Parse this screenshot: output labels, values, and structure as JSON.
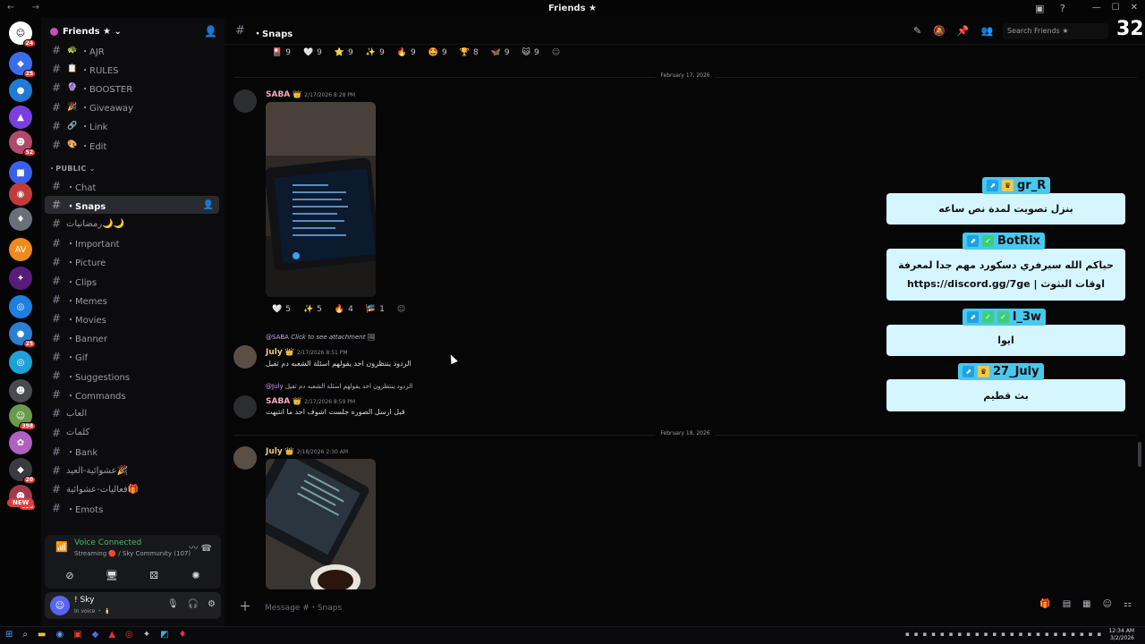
{
  "window": {
    "title": "Friends ★",
    "nav": "← →"
  },
  "colors": {
    "accent": "#5865f2",
    "voice": "#3fbd6a",
    "panel": "#d6f6ff",
    "tag": "#49c8ee",
    "saba": "#f0a8c0",
    "july": "#f0c674"
  },
  "servers": [
    {
      "icon": "☺",
      "color": "#ffffff",
      "badge": "24"
    },
    {
      "icon": "◆",
      "color": "#3a6ee8",
      "badge": "25"
    },
    {
      "icon": "●",
      "color": "#1f7bd6",
      "badge": ""
    },
    {
      "icon": "▲",
      "color": "#7a3fe0",
      "badge": ""
    },
    {
      "icon": "☻",
      "color": "#b04a6a",
      "badge": "52"
    },
    {
      "icon": "■",
      "color": "#3a5fe8",
      "badge": ""
    },
    {
      "icon": "◉",
      "color": "#c23b3b",
      "badge": ""
    },
    {
      "icon": "♦",
      "color": "#6b6f7a",
      "badge": ""
    },
    {
      "icon": "AV",
      "color": "#f08a1c",
      "badge": ""
    },
    {
      "icon": "✦",
      "color": "#5a1c7a",
      "badge": ""
    },
    {
      "icon": "◎",
      "color": "#1d7fe0",
      "badge": ""
    },
    {
      "icon": "●",
      "color": "#2a7fd0",
      "badge": "25"
    },
    {
      "icon": "◎",
      "color": "#1fa0d6",
      "badge": ""
    },
    {
      "icon": "☻",
      "color": "#4a4b50",
      "badge": ""
    },
    {
      "icon": "☺",
      "color": "#6a9a4a",
      "badge": "398"
    },
    {
      "icon": "✿",
      "color": "#b060c0",
      "badge": ""
    },
    {
      "icon": "◆",
      "color": "#3a3b40",
      "badge": "20"
    },
    {
      "icon": "☻",
      "color": "#a03a4a",
      "badge": "398"
    }
  ],
  "new_badge": "NEW",
  "guild": {
    "name": "Friends ★ ⌄"
  },
  "channels_top": [
    {
      "emoji": "🐢",
      "label": "・AJR"
    },
    {
      "emoji": "📋",
      "label": "・RULES"
    },
    {
      "emoji": "🔮",
      "label": "・BOOSTER"
    },
    {
      "emoji": "🎉",
      "label": "・Giveaway"
    },
    {
      "emoji": "🔗",
      "label": "・Link"
    },
    {
      "emoji": "🎨",
      "label": "・Edit"
    }
  ],
  "category_public": "・PUBLIC ⌄",
  "channels_public": [
    {
      "emoji": "",
      "label": "・Chat"
    },
    {
      "emoji": "",
      "label": "・Snaps"
    },
    {
      "emoji": "",
      "label": "رمضانيات🌙🌙"
    },
    {
      "emoji": "",
      "label": "・Important"
    },
    {
      "emoji": "",
      "label": "・Picture"
    },
    {
      "emoji": "",
      "label": "・Clips"
    },
    {
      "emoji": "",
      "label": "・Memes"
    },
    {
      "emoji": "",
      "label": "・Movies"
    },
    {
      "emoji": "",
      "label": "・Banner"
    },
    {
      "emoji": "",
      "label": "・Gif"
    },
    {
      "emoji": "",
      "label": "・Suggestions"
    },
    {
      "emoji": "",
      "label": "・Commands"
    },
    {
      "emoji": "",
      "label": "العاب"
    },
    {
      "emoji": "",
      "label": "كلمات"
    },
    {
      "emoji": "",
      "label": "・Bank"
    },
    {
      "emoji": "",
      "label": "عشوائية-العيد🎉"
    },
    {
      "emoji": "",
      "label": "فعاليات-عشوائية🎁"
    },
    {
      "emoji": "",
      "label": "・Emots"
    }
  ],
  "voice": {
    "status": "Voice Connected",
    "detail": "Streaming 🔴 / Sky Community (107)"
  },
  "user": {
    "name": "! Sky",
    "status": "In voice ・ 🕯️"
  },
  "header": {
    "channel": "・Snaps",
    "search_placeholder": "Search Friends ★"
  },
  "overlay_number": "32",
  "reactions_top": [
    {
      "e": "🎴",
      "n": "9"
    },
    {
      "e": "🤍",
      "n": "9"
    },
    {
      "e": "⭐",
      "n": "9"
    },
    {
      "e": "✨",
      "n": "9"
    },
    {
      "e": "🔥",
      "n": "9"
    },
    {
      "e": "🤩",
      "n": "9"
    },
    {
      "e": "🏆",
      "n": "8"
    },
    {
      "e": "🦋",
      "n": "9"
    },
    {
      "e": "😺",
      "n": "9"
    }
  ],
  "date1": "February 17, 2026",
  "date2": "February 18, 2026",
  "messages": {
    "m1": {
      "author": "SABA",
      "crown": "👑",
      "time": "2/17/2026 8:28 PM"
    },
    "m1_reacts": [
      {
        "e": "🤍",
        "n": "5"
      },
      {
        "e": "✨",
        "n": "5"
      },
      {
        "e": "🔥",
        "n": "4"
      },
      {
        "e": "🎏",
        "n": "1"
      }
    ],
    "m2": {
      "reply_to": "@SABA",
      "reply_text": "Click to see attachment",
      "author": "July",
      "crown": "👑",
      "time": "2/17/2026 8:51 PM",
      "text": "الردود ينتظرون احد يقولهم اسئلة الشعبه دم ثقيل"
    },
    "m3": {
      "reply_to": "@July",
      "reply_text": "الردود ينتظرون احد يقولهم اسئلة الشعبه دم ثقيل",
      "author": "SABA",
      "crown": "👑",
      "time": "2/17/2026 8:59 PM",
      "text": "قبل ارسل الصوره جلست اشوف احد ما انتبهت"
    },
    "m4": {
      "author": "July",
      "crown": "👑",
      "time": "2/18/2026 2:30 AM"
    }
  },
  "input": {
    "placeholder": "Message #・Snaps",
    "plus": "＋"
  },
  "panels": [
    {
      "tag": "gr_R",
      "text": "بنزل تصويت لمدة نص ساعه"
    },
    {
      "tag": "BotRix",
      "text": "حياكم الله سيرفري دسكورد مهم جدا لمعرفة اوقات البثوث | https://discord.gg/7ge"
    },
    {
      "tag": "l_3w",
      "text": "ايوا"
    },
    {
      "tag": "27_July",
      "text": "بث قطيم"
    }
  ],
  "clock": {
    "time": "12:34 AM",
    "date": "3/2/2026"
  }
}
